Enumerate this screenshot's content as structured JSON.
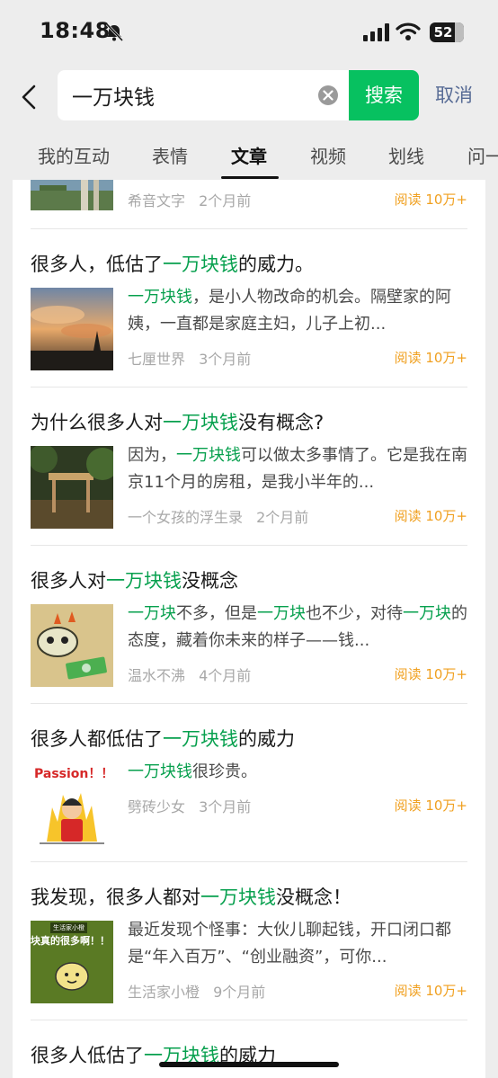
{
  "status_bar": {
    "time": "18:48",
    "battery": "52"
  },
  "search": {
    "query": "一万块钱",
    "button_label": "搜索",
    "cancel_label": "取消"
  },
  "tabs": [
    "我的互动",
    "表情",
    "文章",
    "视频",
    "划线",
    "问一"
  ],
  "active_tab": "文章",
  "reads_label": "阅读 10万+",
  "articles": [
    {
      "source": "希音文字",
      "time": "2个月前",
      "reads": "阅读 10万+"
    },
    {
      "title_pre": "很多人，低估了",
      "title_hl": "一万块钱",
      "title_post": "的威力。",
      "snippet_hl_1": "一万块钱",
      "snippet_rest": "，是小人物改命的机会。隔壁家的阿姨，一直都是家庭主妇，儿子上初...",
      "source": "七厘世界",
      "time": "3个月前",
      "reads": "阅读 10万+"
    },
    {
      "title_pre": "为什么很多人对",
      "title_hl": "一万块钱",
      "title_post": "没有概念?",
      "snippet_pre": "因为，",
      "snippet_hl_1": "一万块钱",
      "snippet_rest": "可以做太多事情了。它是我在南京11个月的房租，是我小半年的...",
      "source": "一个女孩的浮生录",
      "time": "2个月前",
      "reads": "阅读 10万+"
    },
    {
      "title_pre": "很多人对",
      "title_hl": "一万块钱",
      "title_post": "没概念",
      "snippet_hl_1": "一万块",
      "snippet_mid": "不多，但是",
      "snippet_hl_2": "一万块",
      "snippet_mid2": "也不少，对待",
      "snippet_hl_3": "一万块",
      "snippet_rest": "的态度，藏着你未来的样子——钱...",
      "source": "温水不沸",
      "time": "4个月前",
      "reads": "阅读 10万+"
    },
    {
      "title_pre": "很多人都低估了",
      "title_hl": "一万块钱",
      "title_post": "的威力",
      "snippet_hl_1": "一万块钱",
      "snippet_rest": "很珍贵。",
      "thumb_text": "Passion！！",
      "source": "劈砖少女",
      "time": "3个月前",
      "reads": "阅读 10万+"
    },
    {
      "title_pre": "我发现，很多人都对",
      "title_hl": "一万块钱",
      "title_post": "没概念！",
      "snippet_rest": "最近发现个怪事：大伙儿聊起钱，开口闭口都是“年入百万”、“创业融资”，可你...",
      "thumb_small": "生活家小橙",
      "thumb_text": "块真的很多啊！！",
      "source": "生活家小橙",
      "time": "9个月前",
      "reads": "阅读 10万+"
    },
    {
      "title_pre": "很多人低估了",
      "title_hl": "一万块钱",
      "title_post": "的威力"
    }
  ],
  "colors": {
    "accent": "#07c160",
    "highlight": "#07a04e",
    "reads": "#f0a020",
    "link": "#576b95"
  }
}
